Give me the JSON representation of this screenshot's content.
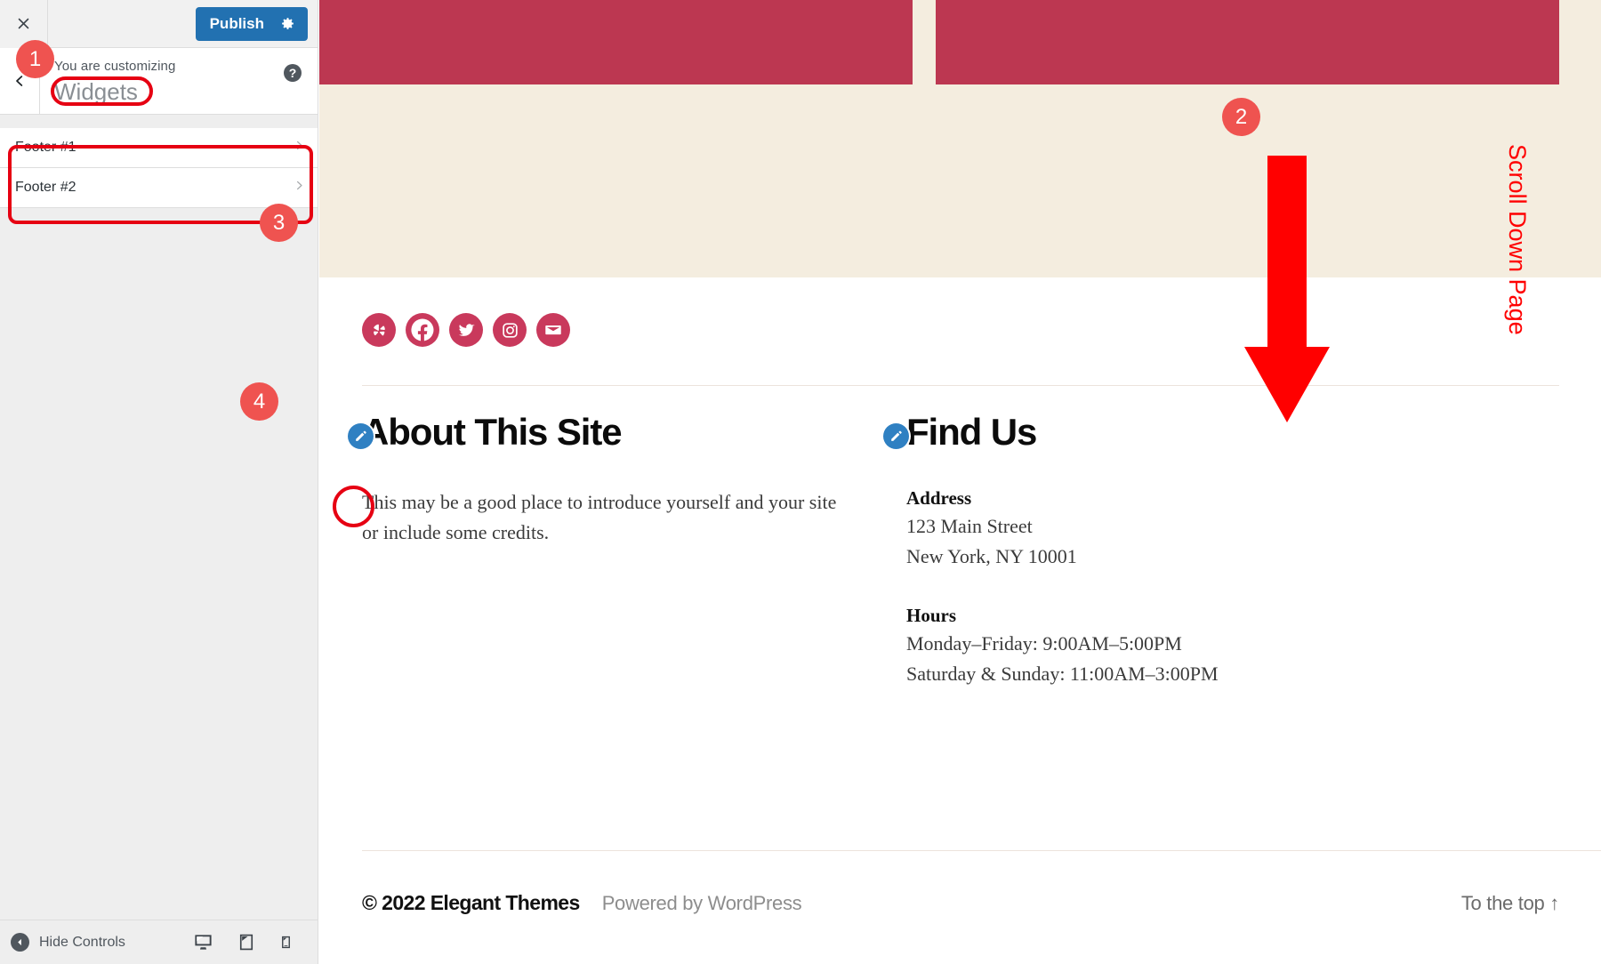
{
  "customizer": {
    "close_icon": "close-icon",
    "publish_label": "Publish",
    "gear_icon": "gear-icon",
    "back_icon": "chevron-left-icon",
    "preamble": "You are customizing",
    "panel_title": "Widgets",
    "help_icon": "help-icon",
    "sections": [
      {
        "label": "Footer #1",
        "chevron": "chevron-right-icon"
      },
      {
        "label": "Footer #2",
        "chevron": "chevron-right-icon"
      }
    ],
    "footer": {
      "hide_controls_label": "Hide Controls",
      "hide_icon": "collapse-left-icon",
      "devices": [
        {
          "name": "desktop-preview-icon"
        },
        {
          "name": "tablet-preview-icon"
        },
        {
          "name": "mobile-preview-icon"
        }
      ]
    }
  },
  "preview": {
    "social_icons": [
      {
        "name": "yelp-icon"
      },
      {
        "name": "facebook-icon"
      },
      {
        "name": "twitter-icon"
      },
      {
        "name": "instagram-icon"
      },
      {
        "name": "email-icon"
      }
    ],
    "widgets": [
      {
        "title": "About This Site",
        "paragraph": "This may be a good place to introduce yourself and your site or include some credits."
      },
      {
        "title": "Find Us",
        "address_heading": "Address",
        "address_line1": "123 Main Street",
        "address_line2": "New York, NY 10001",
        "hours_heading": "Hours",
        "hours_line1": "Monday–Friday: 9:00AM–5:00PM",
        "hours_line2": "Saturday & Sunday: 11:00AM–3:00PM"
      }
    ],
    "footer": {
      "copyright": "© 2022 Elegant Themes",
      "powered_by": "Powered by WordPress",
      "to_the_top": "To the top ↑"
    }
  },
  "annotations": {
    "badge_1": "1",
    "badge_2": "2",
    "badge_3": "3",
    "badge_4": "4",
    "scroll_label": "Scroll Down Page",
    "highlight_color": "#e60012",
    "badge_color": "#ef5350",
    "arrow_color": "#ff0000"
  },
  "colors": {
    "publish_blue": "#2271b1",
    "hero_beige": "#f4eddf",
    "hero_block_crimson": "#bc3751",
    "social_crimson": "#c9395c",
    "pencil_blue": "#2f80c2"
  }
}
